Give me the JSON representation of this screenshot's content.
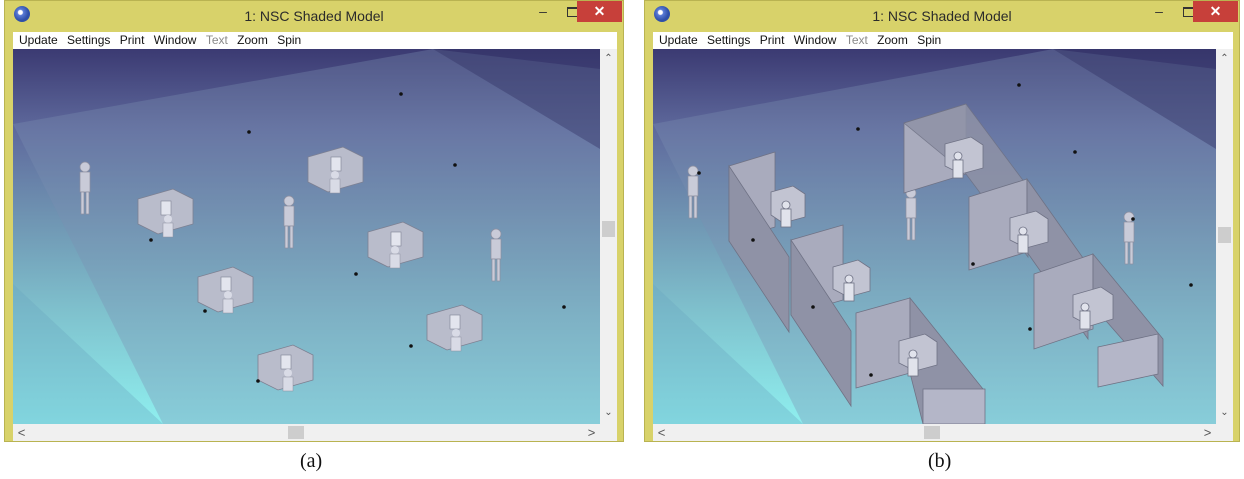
{
  "windows": [
    {
      "id": "a",
      "title": "1: NSC Shaded Model",
      "caption": "(a)",
      "menu": [
        "Update",
        "Settings",
        "Print",
        "Window",
        "Text",
        "Zoom",
        "Spin"
      ],
      "disabled_menu_items": [
        "Text"
      ],
      "scene": "Office room with six desks with seated occupants and three standing figures, no partitions"
    },
    {
      "id": "b",
      "title": "1: NSC Shaded Model",
      "caption": "(b)",
      "menu": [
        "Update",
        "Settings",
        "Print",
        "Window",
        "Text",
        "Zoom",
        "Spin"
      ],
      "disabled_menu_items": [
        "Text"
      ],
      "scene": "Office room with six cubicles separated by partition walls, seated occupants and standing figures"
    }
  ],
  "colors": {
    "frame": "#d8d26a",
    "close_button": "#c7403a",
    "viewport_top": "#3b3a72",
    "viewport_bottom": "#8fefef"
  },
  "icons": {
    "app": "zemax-app-icon",
    "minimize": "minimize-icon",
    "maximize": "maximize-icon",
    "close": "close-icon"
  }
}
